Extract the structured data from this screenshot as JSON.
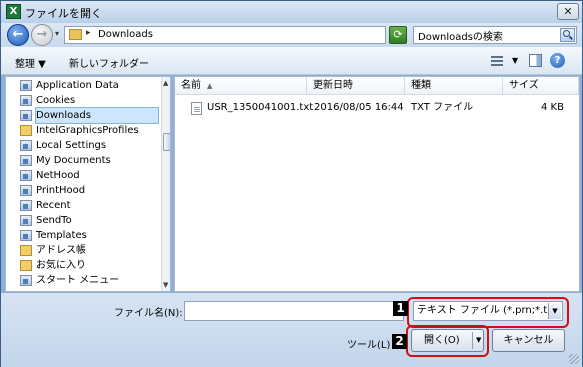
{
  "window": {
    "title": "ファイルを開く",
    "app_icon_letter": "X",
    "close_label": "✕"
  },
  "address_bar": {
    "back_icon": "arrow-left-icon",
    "back_glyph": "←",
    "forward_icon": "arrow-right-icon",
    "forward_glyph": "→",
    "path_separator": "▸",
    "path": "Downloads",
    "dropdown_glyph": "▾",
    "refresh_glyph": "⟳"
  },
  "search": {
    "value": "Downloadsの検索",
    "placeholder": "Downloadsの検索"
  },
  "toolbar": {
    "organize_label": "整理 ▼",
    "new_folder_label": "新しいフォルダー",
    "view_dropdown_glyph": "▼",
    "help_glyph": "?"
  },
  "nav_pane": {
    "items": [
      {
        "label": "Application Data",
        "icon": "shortcut-folder-icon"
      },
      {
        "label": "Cookies",
        "icon": "shortcut-folder-icon"
      },
      {
        "label": "Downloads",
        "icon": "shortcut-folder-icon",
        "selected": true
      },
      {
        "label": "IntelGraphicsProfiles",
        "icon": "folder-icon"
      },
      {
        "label": "Local Settings",
        "icon": "shortcut-folder-icon"
      },
      {
        "label": "My Documents",
        "icon": "shortcut-folder-icon"
      },
      {
        "label": "NetHood",
        "icon": "shortcut-folder-icon"
      },
      {
        "label": "PrintHood",
        "icon": "shortcut-folder-icon"
      },
      {
        "label": "Recent",
        "icon": "shortcut-folder-icon"
      },
      {
        "label": "SendTo",
        "icon": "shortcut-folder-icon"
      },
      {
        "label": "Templates",
        "icon": "shortcut-folder-icon"
      },
      {
        "label": "アドレス帳",
        "icon": "folder-icon"
      },
      {
        "label": "お気に入り",
        "icon": "folder-icon"
      },
      {
        "label": "スタート メニュー",
        "icon": "shortcut-folder-icon"
      }
    ]
  },
  "file_list": {
    "columns": [
      "名前",
      "更新日時",
      "種類",
      "サイズ"
    ],
    "sort_glyph": "▲",
    "rows": [
      {
        "name": "USR_1350041001.txt",
        "modified": "2016/08/05 16:44",
        "type": "TXT ファイル",
        "size": "4 KB"
      }
    ]
  },
  "footer": {
    "filename_label": "ファイル名(N):",
    "filename_value": "",
    "filter_value": "テキスト ファイル (*.prn;*.txt;",
    "tools_label": "ツール(L)",
    "tools_drop_glyph": "▼",
    "open_label": "開く(O)",
    "open_drop_glyph": "▼",
    "cancel_label": "キャンセル"
  },
  "callouts": [
    "1",
    "2"
  ],
  "colors": {
    "callout_border": "#d01010",
    "selected_bg": "#cde6fb"
  }
}
